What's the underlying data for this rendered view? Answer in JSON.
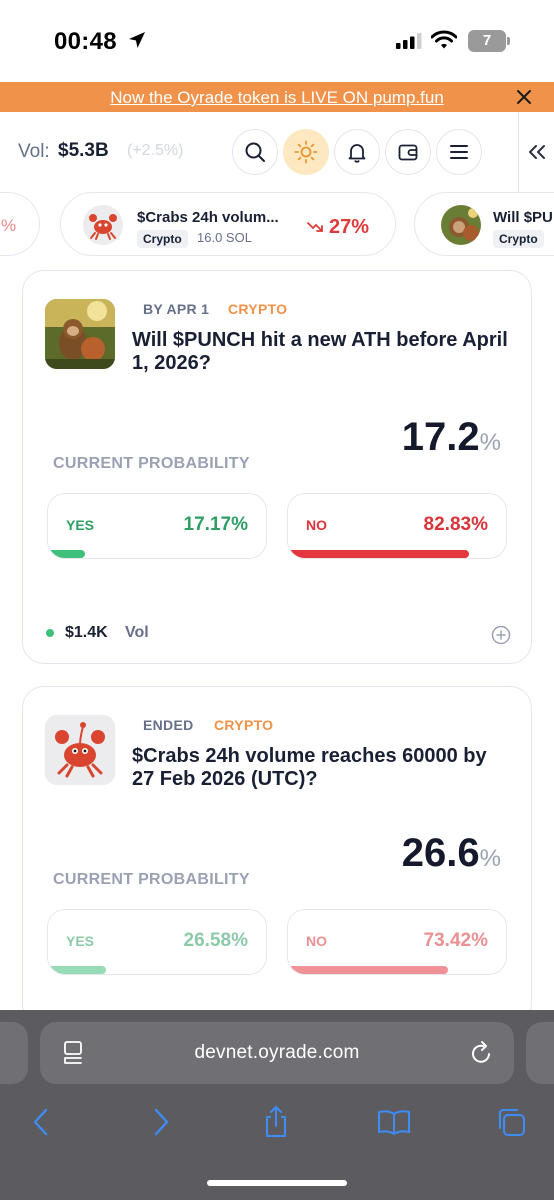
{
  "status_bar": {
    "time": "00:48",
    "battery": "7"
  },
  "banner": {
    "text": "Now the Oyrade token is LIVE ON pump.fun"
  },
  "header": {
    "vol_label": "Vol:",
    "vol_value": "$5.3B",
    "vol_change": "(+2.5%)"
  },
  "ticker": {
    "left_edge_text": "%",
    "items": [
      {
        "title": "$Crabs 24h volum...",
        "category": "Crypto",
        "sol": "16.0 SOL",
        "change": "27%",
        "direction": "down"
      },
      {
        "title": "Will $PU",
        "category": "Crypto"
      }
    ]
  },
  "markets": [
    {
      "date": "BY APR 1",
      "category": "CRYPTO",
      "question": "Will $PUNCH hit a new ATH before April 1, 2026?",
      "prob_value": "17.2",
      "prob_unit": "%",
      "prob_label": "CURRENT PROBABILITY",
      "yes_label": "YES",
      "yes_pct": "17.17%",
      "yes_fraction": 0.1717,
      "no_label": "NO",
      "no_pct": "82.83%",
      "no_fraction": 0.8283,
      "volume": "$1.4K",
      "volume_label": "Vol"
    },
    {
      "date": "ENDED",
      "category": "CRYPTO",
      "question": "$Crabs 24h volume reaches 60000 by 27 Feb 2026 (UTC)?",
      "prob_value": "26.6",
      "prob_unit": "%",
      "prob_label": "CURRENT PROBABILITY",
      "yes_label": "YES",
      "yes_pct": "26.58%",
      "yes_fraction": 0.2658,
      "no_label": "NO",
      "no_pct": "73.42%",
      "no_fraction": 0.7342
    }
  ],
  "safari": {
    "url": "devnet.oyrade.com"
  },
  "colors": {
    "accent": "#f0924a",
    "yes": "#2e9e62",
    "no": "#d9353a"
  }
}
